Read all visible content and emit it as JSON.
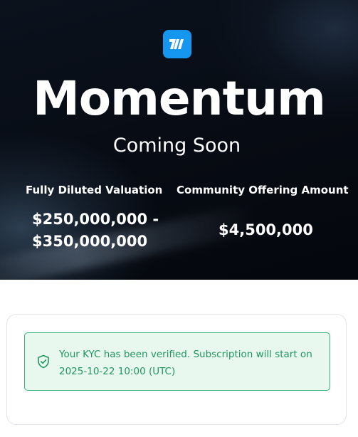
{
  "hero": {
    "logo_text": "M",
    "title": "Momentum",
    "subtitle": "Coming Soon",
    "stats": [
      {
        "label": "Fully Diluted Valuation",
        "value_line1": "$250,000,000 -",
        "value_line2": "$350,000,000"
      },
      {
        "label": "Community Offering Amount",
        "value": "$4,500,000"
      }
    ]
  },
  "kyc": {
    "icon": "shield-check-icon",
    "message": "Your KYC has been verified. Subscription will start on 2025-10-22 10:00 (UTC)"
  },
  "colors": {
    "logo_blue": "#1597f0",
    "success_green": "#1f9660",
    "success_bg": "#e8f8ee"
  }
}
